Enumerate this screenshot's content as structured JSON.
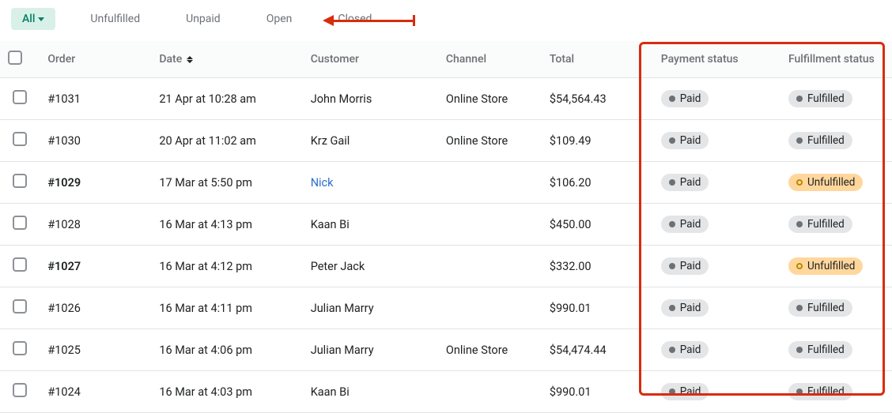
{
  "tabs": {
    "all": "All",
    "unfulfilled": "Unfulfilled",
    "unpaid": "Unpaid",
    "open": "Open",
    "closed": "Closed"
  },
  "headers": {
    "order": "Order",
    "date": "Date",
    "customer": "Customer",
    "channel": "Channel",
    "total": "Total",
    "payment_status": "Payment status",
    "fulfillment_status": "Fulfillment status"
  },
  "rows": [
    {
      "order": "#1031",
      "date": "21 Apr at 10:28 am",
      "customer": "John Morris",
      "channel": "Online Store",
      "total": "$54,564.43",
      "payment": "Paid",
      "fulfillment": "Fulfilled",
      "unfulfilled": false,
      "customer_link": false
    },
    {
      "order": "#1030",
      "date": "20 Apr at 11:02 am",
      "customer": "Krz Gail",
      "channel": "Online Store",
      "total": "$109.49",
      "payment": "Paid",
      "fulfillment": "Fulfilled",
      "unfulfilled": false,
      "customer_link": false
    },
    {
      "order": "#1029",
      "date": "17 Mar at 5:50 pm",
      "customer": "Nick",
      "channel": "",
      "total": "$106.20",
      "payment": "Paid",
      "fulfillment": "Unfulfilled",
      "unfulfilled": true,
      "customer_link": true
    },
    {
      "order": "#1028",
      "date": "16 Mar at 4:13 pm",
      "customer": "Kaan Bi",
      "channel": "",
      "total": "$450.00",
      "payment": "Paid",
      "fulfillment": "Fulfilled",
      "unfulfilled": false,
      "customer_link": false
    },
    {
      "order": "#1027",
      "date": "16 Mar at 4:12 pm",
      "customer": "Peter Jack",
      "channel": "",
      "total": "$332.00",
      "payment": "Paid",
      "fulfillment": "Unfulfilled",
      "unfulfilled": true,
      "customer_link": false
    },
    {
      "order": "#1026",
      "date": "16 Mar at 4:11 pm",
      "customer": "Julian Marry",
      "channel": "",
      "total": "$990.01",
      "payment": "Paid",
      "fulfillment": "Fulfilled",
      "unfulfilled": false,
      "customer_link": false
    },
    {
      "order": "#1025",
      "date": "16 Mar at 4:06 pm",
      "customer": "Julian Marry",
      "channel": "Online Store",
      "total": "$54,474.44",
      "payment": "Paid",
      "fulfillment": "Fulfilled",
      "unfulfilled": false,
      "customer_link": false
    },
    {
      "order": "#1024",
      "date": "16 Mar at 4:03 pm",
      "customer": "Kaan Bi",
      "channel": "",
      "total": "$990.01",
      "payment": "Paid",
      "fulfillment": "Fulfilled",
      "unfulfilled": false,
      "customer_link": false
    }
  ]
}
